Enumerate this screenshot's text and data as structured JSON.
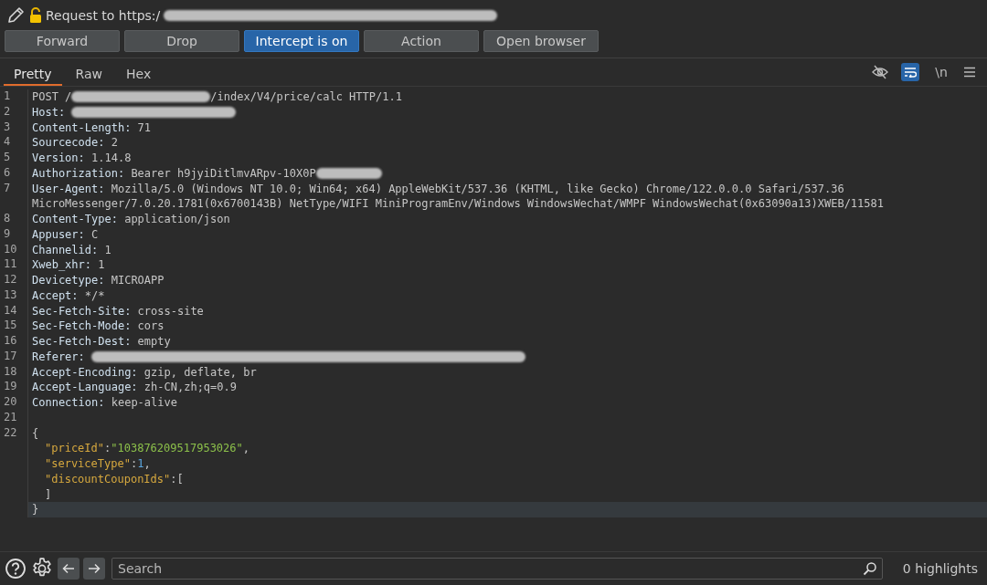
{
  "title": {
    "text": "Request to https:/",
    "redacted": true
  },
  "buttons": [
    {
      "label": "Forward",
      "selected": false
    },
    {
      "label": "Drop",
      "selected": false
    },
    {
      "label": "Intercept is on",
      "selected": true
    },
    {
      "label": "Action",
      "selected": false
    },
    {
      "label": "Open browser",
      "selected": false
    }
  ],
  "tabs": [
    {
      "label": "Pretty",
      "selected": true
    },
    {
      "label": "Raw",
      "selected": false
    },
    {
      "label": "Hex",
      "selected": false
    }
  ],
  "toolbar": {
    "wrap_on": true,
    "newline_label": "\\n"
  },
  "lines": [
    {
      "number": "1",
      "parts": [
        {
          "kind": "plain",
          "text": "POST /"
        },
        {
          "kind": "redaction"
        },
        {
          "kind": "plain",
          "text": "/index/V4/price/calc HTTP/1.1"
        }
      ]
    },
    {
      "number": "2",
      "parts": [
        {
          "kind": "key",
          "text": "Host: "
        },
        {
          "kind": "redaction"
        }
      ]
    },
    {
      "number": "3",
      "parts": [
        {
          "kind": "key",
          "text": "Content-Length: "
        },
        {
          "kind": "value",
          "text": "71"
        }
      ]
    },
    {
      "number": "4",
      "parts": [
        {
          "kind": "key",
          "text": "Sourcecode: "
        },
        {
          "kind": "value",
          "text": "2"
        }
      ]
    },
    {
      "number": "5",
      "parts": [
        {
          "kind": "key",
          "text": "Version: "
        },
        {
          "kind": "value",
          "text": "1.14.8"
        }
      ]
    },
    {
      "number": "6",
      "parts": [
        {
          "kind": "key",
          "text": "Authorization: "
        },
        {
          "kind": "value",
          "text": "Bearer h9jyiDitlmvARpv-10X0P"
        },
        {
          "kind": "redaction"
        }
      ]
    },
    {
      "number": "7",
      "rows": [
        {
          "highlighted": false,
          "parts": [
            {
              "kind": "key",
              "text": "User-Agent: "
            },
            {
              "kind": "value",
              "text": "Mozilla/5.0 (Windows NT 10.0; Win64; x64) AppleWebKit/537.36 (KHTML, like Gecko) Chrome/122.0.0.0 Safari/537.36"
            }
          ]
        },
        {
          "highlighted": false,
          "parts": [
            {
              "kind": "value",
              "text": "MicroMessenger/7.0.20.1781(0x6700143B) NetType/WIFI MiniProgramEnv/Windows WindowsWechat/WMPF WindowsWechat(0x63090a13)XWEB/11581"
            }
          ]
        }
      ]
    },
    {
      "number": "8",
      "parts": [
        {
          "kind": "key",
          "text": "Content-Type: "
        },
        {
          "kind": "value",
          "text": "application/json"
        }
      ]
    },
    {
      "number": "9",
      "parts": [
        {
          "kind": "key",
          "text": "Appuser: "
        },
        {
          "kind": "value",
          "text": "C"
        }
      ]
    },
    {
      "number": "10",
      "parts": [
        {
          "kind": "key",
          "text": "Channelid: "
        },
        {
          "kind": "value",
          "text": "1"
        }
      ]
    },
    {
      "number": "11",
      "parts": [
        {
          "kind": "key",
          "text": "Xweb_xhr: "
        },
        {
          "kind": "value",
          "text": "1"
        }
      ]
    },
    {
      "number": "12",
      "parts": [
        {
          "kind": "key",
          "text": "Devicetype: "
        },
        {
          "kind": "value",
          "text": "MICROAPP"
        }
      ]
    },
    {
      "number": "13",
      "parts": [
        {
          "kind": "key",
          "text": "Accept: "
        },
        {
          "kind": "value",
          "text": "*/*"
        }
      ]
    },
    {
      "number": "14",
      "parts": [
        {
          "kind": "key",
          "text": "Sec-Fetch-Site: "
        },
        {
          "kind": "value",
          "text": "cross-site"
        }
      ]
    },
    {
      "number": "15",
      "parts": [
        {
          "kind": "key",
          "text": "Sec-Fetch-Mode: "
        },
        {
          "kind": "value",
          "text": "cors"
        }
      ]
    },
    {
      "number": "16",
      "parts": [
        {
          "kind": "key",
          "text": "Sec-Fetch-Dest: "
        },
        {
          "kind": "value",
          "text": "empty"
        }
      ]
    },
    {
      "number": "17",
      "parts": [
        {
          "kind": "key",
          "text": "Referer: "
        },
        {
          "kind": "redaction"
        }
      ]
    },
    {
      "number": "18",
      "parts": [
        {
          "kind": "key",
          "text": "Accept-Encoding: "
        },
        {
          "kind": "value",
          "text": "gzip, deflate, br"
        }
      ]
    },
    {
      "number": "19",
      "parts": [
        {
          "kind": "key",
          "text": "Accept-Language: "
        },
        {
          "kind": "value",
          "text": "zh-CN,zh;q=0.9"
        }
      ]
    },
    {
      "number": "20",
      "parts": [
        {
          "kind": "key",
          "text": "Connection: "
        },
        {
          "kind": "value",
          "text": "keep-alive"
        }
      ]
    },
    {
      "number": "21"
    },
    {
      "number": "22",
      "rows": [
        {
          "highlighted": false,
          "parts": [
            {
              "kind": "punct",
              "text": "{"
            }
          ]
        },
        {
          "highlighted": false,
          "parts": [
            {
              "kind": "indent"
            },
            {
              "kind": "jkey",
              "text": "\"priceId\""
            },
            {
              "kind": "punct",
              "text": ":"
            },
            {
              "kind": "jstring",
              "text": "\"103876209517953026\""
            },
            {
              "kind": "punct",
              "text": ","
            }
          ]
        },
        {
          "highlighted": false,
          "parts": [
            {
              "kind": "indent"
            },
            {
              "kind": "jkey",
              "text": "\"serviceType\""
            },
            {
              "kind": "punct",
              "text": ":"
            },
            {
              "kind": "jnumber",
              "text": "1"
            },
            {
              "kind": "punct",
              "text": ","
            }
          ]
        },
        {
          "highlighted": false,
          "parts": [
            {
              "kind": "indent"
            },
            {
              "kind": "jkey",
              "text": "\"discountCouponIds\""
            },
            {
              "kind": "punct",
              "text": ":["
            }
          ]
        },
        {
          "highlighted": false,
          "parts": [
            {
              "kind": "indent"
            },
            {
              "kind": "punct",
              "text": "]"
            }
          ]
        },
        {
          "highlighted": true,
          "parts": [
            {
              "kind": "punct",
              "text": "}"
            }
          ]
        }
      ]
    }
  ],
  "search": {
    "placeholder": "Search"
  },
  "highlights": "0 highlights"
}
